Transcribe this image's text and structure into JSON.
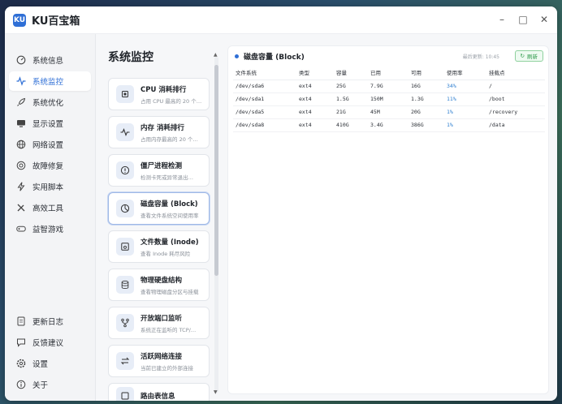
{
  "app": {
    "title": "KU百宝箱",
    "logo_text": "KU",
    "controls": [
      "minimize-icon",
      "maximize-icon",
      "close-icon"
    ]
  },
  "sidebar": {
    "items": [
      {
        "label": "系统信息",
        "icon": "dashboard-icon",
        "active": false
      },
      {
        "label": "系统监控",
        "icon": "pulse-icon",
        "active": true
      },
      {
        "label": "系统优化",
        "icon": "rocket-icon",
        "active": false
      },
      {
        "label": "显示设置",
        "icon": "monitor-icon",
        "active": false
      },
      {
        "label": "网络设置",
        "icon": "globe-icon",
        "active": false
      },
      {
        "label": "故障修复",
        "icon": "lifebuoy-icon",
        "active": false
      },
      {
        "label": "实用脚本",
        "icon": "lightning-icon",
        "active": false
      },
      {
        "label": "高效工具",
        "icon": "tools-icon",
        "active": false
      },
      {
        "label": "益智游戏",
        "icon": "gamepad-icon",
        "active": false
      }
    ],
    "bottom_items": [
      {
        "label": "更新日志",
        "icon": "document-icon"
      },
      {
        "label": "反馈建议",
        "icon": "chat-icon"
      },
      {
        "label": "设置",
        "icon": "gear-icon"
      },
      {
        "label": "关于",
        "icon": "info-icon"
      }
    ]
  },
  "monitor": {
    "title": "系统监控",
    "cards": [
      {
        "title": "CPU 消耗排行",
        "sub": "占用 CPU 最高的 20 个…",
        "icon": "cpu-icon",
        "active": false
      },
      {
        "title": "内存 消耗排行",
        "sub": "占用内存最高的 20 个…",
        "icon": "memory-pulse-icon",
        "active": false
      },
      {
        "title": "僵尸进程检测",
        "sub": "检测卡死或异常退出…",
        "icon": "alert-circle-icon",
        "active": false
      },
      {
        "title": "磁盘容量 (Block)",
        "sub": "查看文件系统空间使用率",
        "icon": "pie-chart-icon",
        "active": true
      },
      {
        "title": "文件数量 (Inode)",
        "sub": "查看 Inode 耗尽风险",
        "icon": "disk-save-icon",
        "active": false
      },
      {
        "title": "物理硬盘结构",
        "sub": "查看物理磁盘分区与挂载",
        "icon": "database-icon",
        "active": false
      },
      {
        "title": "开放端口监听",
        "sub": "系统正在监听的 TCP/…",
        "icon": "branch-icon",
        "active": false
      },
      {
        "title": "活跃网络连接",
        "sub": "当前已建立的外部连接",
        "icon": "swap-icon",
        "active": false
      },
      {
        "title": "路由表信息",
        "sub": "",
        "icon": "route-icon",
        "active": false
      }
    ]
  },
  "disk": {
    "title": "磁盘容量 (Block)",
    "updated": "最后更新: 10:45",
    "refresh_label": "刷新",
    "columns": [
      "文件系统",
      "类型",
      "容量",
      "已用",
      "可用",
      "使用率",
      "挂载点"
    ],
    "rows": [
      [
        "/dev/sda6",
        "ext4",
        "25G",
        "7.9G",
        "16G",
        "34%",
        "/"
      ],
      [
        "/dev/sda1",
        "ext4",
        "1.5G",
        "150M",
        "1.3G",
        "11%",
        "/boot"
      ],
      [
        "/dev/sda5",
        "ext4",
        "21G",
        "45M",
        "20G",
        "1%",
        "/recovery"
      ],
      [
        "/dev/sda8",
        "ext4",
        "410G",
        "3.4G",
        "386G",
        "1%",
        "/data"
      ]
    ]
  },
  "colors": {
    "accent": "#2f6fd6",
    "usage": "#2f7fd0",
    "refresh": "#2f9a4b"
  }
}
